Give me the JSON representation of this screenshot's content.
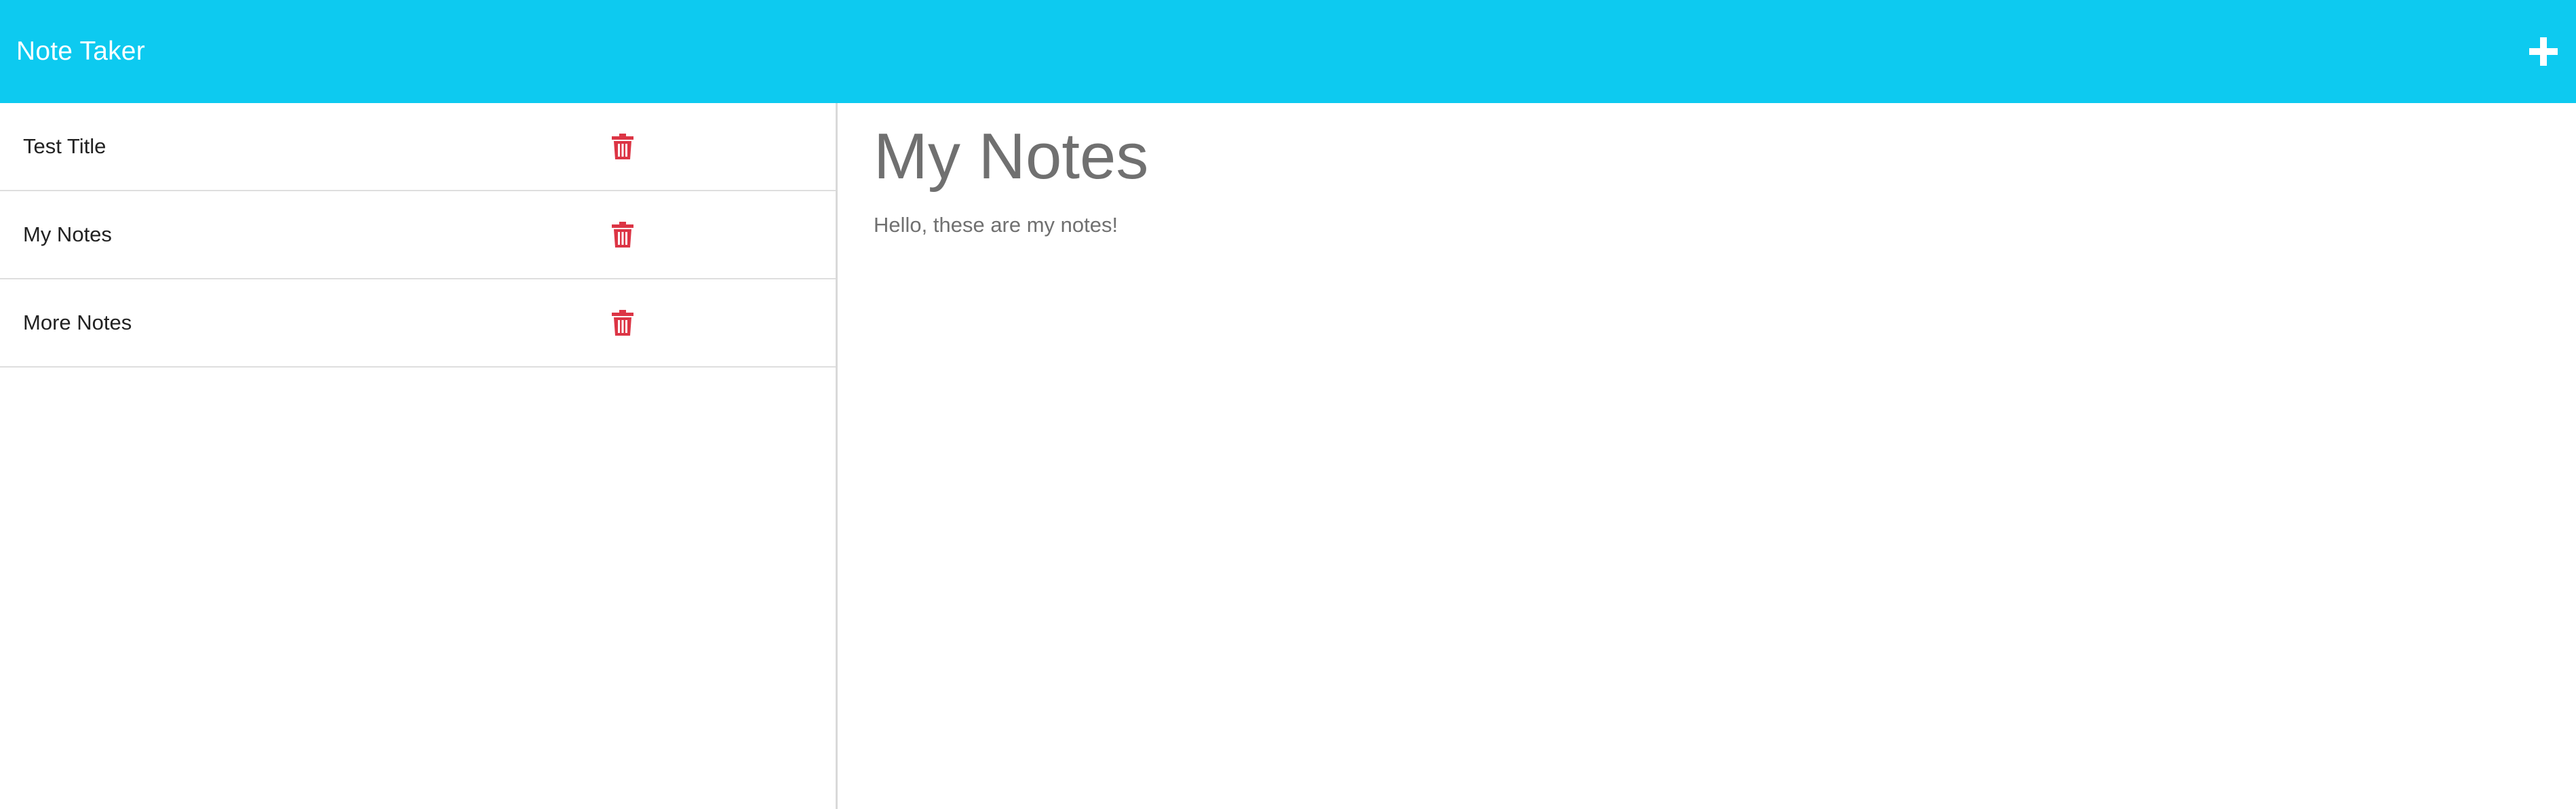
{
  "navbar": {
    "brand": "Note Taker",
    "new_note_icon": "plus-icon"
  },
  "colors": {
    "navbar_bg": "#0dcaf0",
    "delete_icon": "#dc3545",
    "note_text": "#707070"
  },
  "sidebar": {
    "notes": [
      {
        "title": "Test Title",
        "delete_icon": "trash-icon"
      },
      {
        "title": "My Notes",
        "delete_icon": "trash-icon"
      },
      {
        "title": "More Notes",
        "delete_icon": "trash-icon"
      }
    ]
  },
  "active_note": {
    "title": "My Notes",
    "text": "Hello, these are my notes!"
  }
}
